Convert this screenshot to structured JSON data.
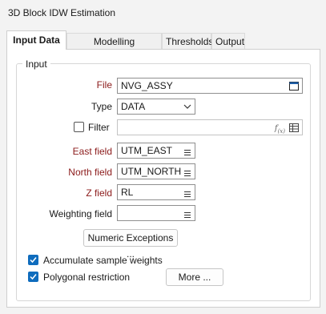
{
  "window": {
    "title": "3D Block IDW Estimation"
  },
  "tabs": [
    {
      "label": "Input Data",
      "active": true
    },
    {
      "label": "Modelling Parameters",
      "active": false
    },
    {
      "label": "Thresholds",
      "active": false
    },
    {
      "label": "Output",
      "active": false
    }
  ],
  "group": {
    "label": "Input"
  },
  "fields": {
    "file": {
      "label": "File",
      "value": "NVG_ASSY"
    },
    "type": {
      "label": "Type",
      "value": "DATA"
    },
    "filter": {
      "label": "Filter",
      "value": "",
      "checked": false
    },
    "east": {
      "label": "East field",
      "value": "UTM_EAST"
    },
    "north": {
      "label": "North field",
      "value": "UTM_NORTH"
    },
    "z": {
      "label": "Z field",
      "value": "RL"
    },
    "weighting": {
      "label": "Weighting field",
      "value": ""
    }
  },
  "buttons": {
    "numeric_exceptions": "Numeric Exceptions ...",
    "more": "More ..."
  },
  "checkboxes": {
    "accumulate": {
      "label": "Accumulate sample weights",
      "checked": true
    },
    "polygonal": {
      "label": "Polygonal restriction",
      "checked": true
    }
  },
  "icons": {
    "file_browse": "file-browse-icon",
    "dropdown": "chevron-down-icon",
    "field_list": "list-icon",
    "expression": "fx-icon",
    "table": "table-icon"
  },
  "colors": {
    "required_label": "#8b1a1a",
    "checkbox_accent": "#0f6cbd"
  }
}
